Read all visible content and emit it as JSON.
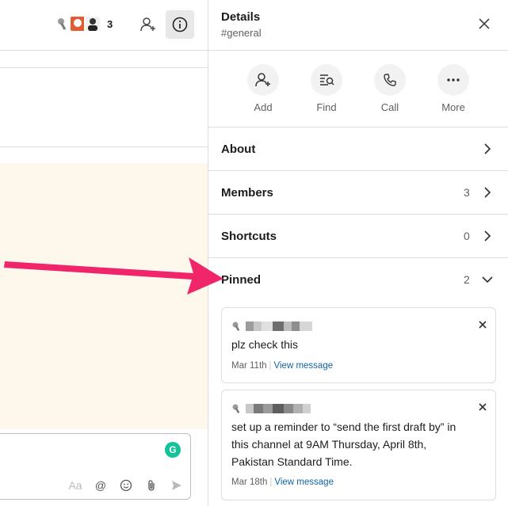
{
  "channel_header": {
    "member_count": "3"
  },
  "composer": {
    "tools": [
      "Aa",
      "@",
      "☺",
      "📎",
      "➤"
    ]
  },
  "details": {
    "title": "Details",
    "subtitle": "#general",
    "actions": [
      {
        "label": "Add",
        "icon": "add-person-icon"
      },
      {
        "label": "Find",
        "icon": "find-icon"
      },
      {
        "label": "Call",
        "icon": "phone-icon"
      },
      {
        "label": "More",
        "icon": "more-icon"
      }
    ],
    "sections": {
      "about": {
        "label": "About"
      },
      "members": {
        "label": "Members",
        "count": "3"
      },
      "shortcuts": {
        "label": "Shortcuts",
        "count": "0"
      },
      "pinned": {
        "label": "Pinned",
        "count": "2"
      }
    },
    "pins": [
      {
        "text": "plz check this",
        "date": "Mar 11th",
        "link": "View message"
      },
      {
        "text_lines": [
          "set up a reminder to “send the first draft by” in",
          "this channel at 9AM Thursday, April 8th,",
          "Pakistan Standard Time."
        ],
        "date": "Mar 18th",
        "link": "View message"
      }
    ]
  },
  "colors": {
    "arrow": "#f0256a",
    "highlight": "#fef7ec",
    "link": "#1264a3"
  }
}
